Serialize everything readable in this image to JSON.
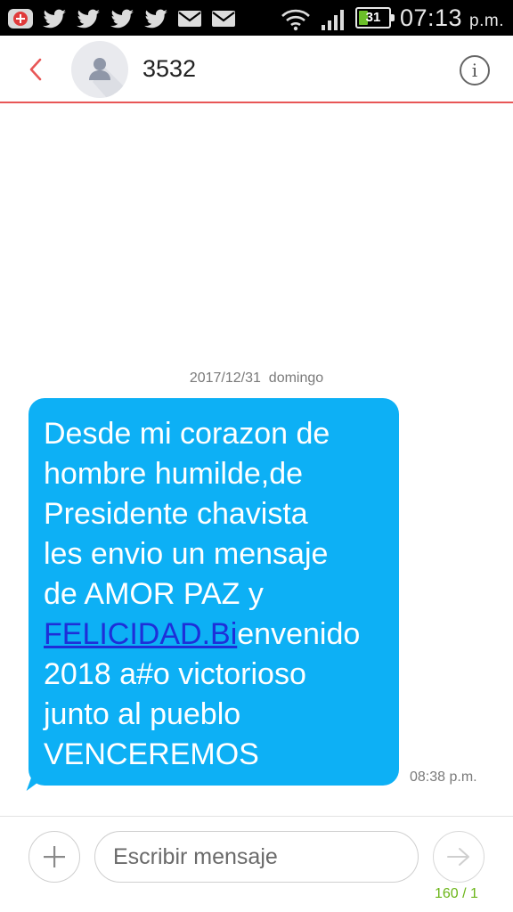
{
  "status_bar": {
    "icons_left": [
      "add-alert-icon",
      "twitter-icon",
      "twitter-icon",
      "twitter-icon",
      "twitter-icon",
      "mail-icon",
      "mail-icon"
    ],
    "icons_right": [
      "wifi-icon",
      "signal-icon",
      "battery-icon"
    ],
    "battery_level": "31",
    "time": "07:13",
    "time_suffix": "p.m.",
    "accent_green": "#6bbf2a"
  },
  "header": {
    "contact_name": "3532",
    "accent_color": "#e85656"
  },
  "conversation": {
    "date": "2017/12/31",
    "day": "domingo",
    "message": {
      "lines_before_link": [
        "Desde mi corazon de",
        "hombre humilde,de",
        "Presidente chavista",
        "les envio un mensaje",
        "de AMOR PAZ y"
      ],
      "link_text": "FELICIDAD.Bi",
      "after_link": "envenido",
      "lines_after_link": [
        "2018 a#o victorioso",
        "junto al pueblo",
        "VENCEREMOS"
      ],
      "time": "08:38 p.m.",
      "bubble_color": "#0db0f5"
    }
  },
  "composer": {
    "placeholder": "Escribir mensaje",
    "counter": "160 / 1",
    "counter_color": "#6bb518"
  }
}
